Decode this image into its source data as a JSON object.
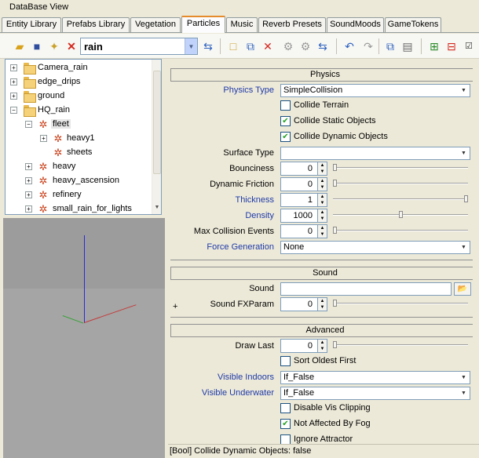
{
  "window": {
    "title": "DataBase View"
  },
  "tabs": [
    {
      "label": "Entity Library",
      "active": false
    },
    {
      "label": "Prefabs Library",
      "active": false
    },
    {
      "label": "Vegetation",
      "active": false
    },
    {
      "label": "Particles",
      "active": true
    },
    {
      "label": "Music",
      "active": false
    },
    {
      "label": "Reverb Presets",
      "active": false
    },
    {
      "label": "SoundMoods",
      "active": false
    },
    {
      "label": "GameTokens",
      "active": false
    }
  ],
  "toolbar": {
    "library_value": "rain",
    "icons": [
      "open-folder-icon",
      "save-icon",
      "new-library-icon",
      "delete-library-icon",
      "reload-icon",
      "add-item-icon",
      "clone-icon",
      "remove-item-icon",
      "assign-icon",
      "get-icon",
      "refresh-icon",
      "undo-icon",
      "redo-icon",
      "copy-icon",
      "paste-icon",
      "add-child-icon",
      "remove-child-icon",
      "toggle-icon"
    ]
  },
  "tree": {
    "items": [
      {
        "label": "Camera_rain",
        "kind": "folder",
        "level": 0,
        "expander": "+"
      },
      {
        "label": "edge_drips",
        "kind": "folder",
        "level": 0,
        "expander": "+"
      },
      {
        "label": "ground",
        "kind": "folder",
        "level": 0,
        "expander": "+"
      },
      {
        "label": "HQ_rain",
        "kind": "folder",
        "level": 0,
        "expander": "−"
      },
      {
        "label": "fleet",
        "kind": "effect",
        "level": 1,
        "expander": "−",
        "selected": true
      },
      {
        "label": "heavy1",
        "kind": "effect",
        "level": 2,
        "expander": "+"
      },
      {
        "label": "sheets",
        "kind": "effect",
        "level": 2,
        "expander": ""
      },
      {
        "label": "heavy",
        "kind": "effect",
        "level": 1,
        "expander": "+"
      },
      {
        "label": "heavy_ascension",
        "kind": "effect",
        "level": 1,
        "expander": "+"
      },
      {
        "label": "refinery",
        "kind": "effect",
        "level": 1,
        "expander": "+"
      },
      {
        "label": "small_rain_for_lights",
        "kind": "effect",
        "level": 1,
        "expander": "+"
      }
    ]
  },
  "physics": {
    "header": "Physics",
    "physics_type": {
      "label": "Physics Type",
      "value": "SimpleCollision"
    },
    "collide_terrain": {
      "label": "Collide Terrain",
      "checked": false
    },
    "collide_static": {
      "label": "Collide Static Objects",
      "checked": true
    },
    "collide_dynamic": {
      "label": "Collide Dynamic Objects",
      "checked": true
    },
    "surface_type": {
      "label": "Surface Type",
      "value": ""
    },
    "bounciness": {
      "label": "Bounciness",
      "value": "0",
      "slider_fraction": 0.0
    },
    "dynamic_friction": {
      "label": "Dynamic Friction",
      "value": "0",
      "slider_fraction": 0.0
    },
    "thickness": {
      "label": "Thickness",
      "value": "1",
      "slider_fraction": 1.0
    },
    "density": {
      "label": "Density",
      "value": "1000",
      "slider_fraction": 0.5
    },
    "max_collision_events": {
      "label": "Max Collision Events",
      "value": "0",
      "slider_fraction": 0.0
    },
    "force_generation": {
      "label": "Force Generation",
      "value": "None"
    }
  },
  "sound": {
    "header": "Sound",
    "sound": {
      "label": "Sound",
      "value": ""
    },
    "sound_fxparam": {
      "label": "Sound FXParam",
      "value": "0",
      "slider_fraction": 0.0
    },
    "plus": "+"
  },
  "advanced": {
    "header": "Advanced",
    "draw_last": {
      "label": "Draw Last",
      "value": "0",
      "slider_fraction": 0.0
    },
    "sort_oldest_first": {
      "label": "Sort Oldest First",
      "checked": false
    },
    "visible_indoors": {
      "label": "Visible Indoors",
      "value": "If_False"
    },
    "visible_underwater": {
      "label": "Visible Underwater",
      "value": "If_False"
    },
    "disable_vis_clipping": {
      "label": "Disable Vis Clipping",
      "checked": false
    },
    "not_affected_by_fog": {
      "label": "Not Affected By Fog",
      "checked": true
    },
    "ignore_attractor": {
      "label": "Ignore Attractor",
      "checked": false
    }
  },
  "status": {
    "text": "[Bool] Collide Dynamic Objects: false"
  },
  "colors": {
    "label_blue": "#1f3aa8",
    "tab_accent": "#e68b2c",
    "check_green": "#21a121"
  }
}
